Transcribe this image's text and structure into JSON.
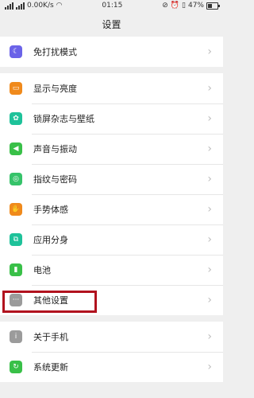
{
  "status": {
    "network_speed": "0.00K/s",
    "time": "01:15",
    "battery_percent": "47%",
    "battery_level": 0.47
  },
  "header": {
    "title": "设置"
  },
  "groups": [
    {
      "items": [
        {
          "label": "免打扰模式",
          "icon": "moon-icon",
          "color": "#6b63e8"
        }
      ]
    },
    {
      "items": [
        {
          "label": "显示与亮度",
          "icon": "display-icon",
          "color": "#f08a1c"
        },
        {
          "label": "锁屏杂志与壁纸",
          "icon": "flower-icon",
          "color": "#1ec29a"
        },
        {
          "label": "声音与振动",
          "icon": "speaker-icon",
          "color": "#39c048"
        },
        {
          "label": "指纹与密码",
          "icon": "fingerprint-icon",
          "color": "#36c36a"
        },
        {
          "label": "手势体感",
          "icon": "hand-icon",
          "color": "#f08a1c"
        },
        {
          "label": "应用分身",
          "icon": "clone-icon",
          "color": "#1ec29a"
        },
        {
          "label": "电池",
          "icon": "battery-icon",
          "color": "#39c048"
        },
        {
          "label": "其他设置",
          "icon": "more-icon",
          "color": "#9b9b9b"
        }
      ]
    },
    {
      "items": [
        {
          "label": "关于手机",
          "icon": "info-icon",
          "color": "#9b9b9b"
        },
        {
          "label": "系统更新",
          "icon": "update-icon",
          "color": "#39c048"
        }
      ]
    }
  ],
  "chevron": "›"
}
